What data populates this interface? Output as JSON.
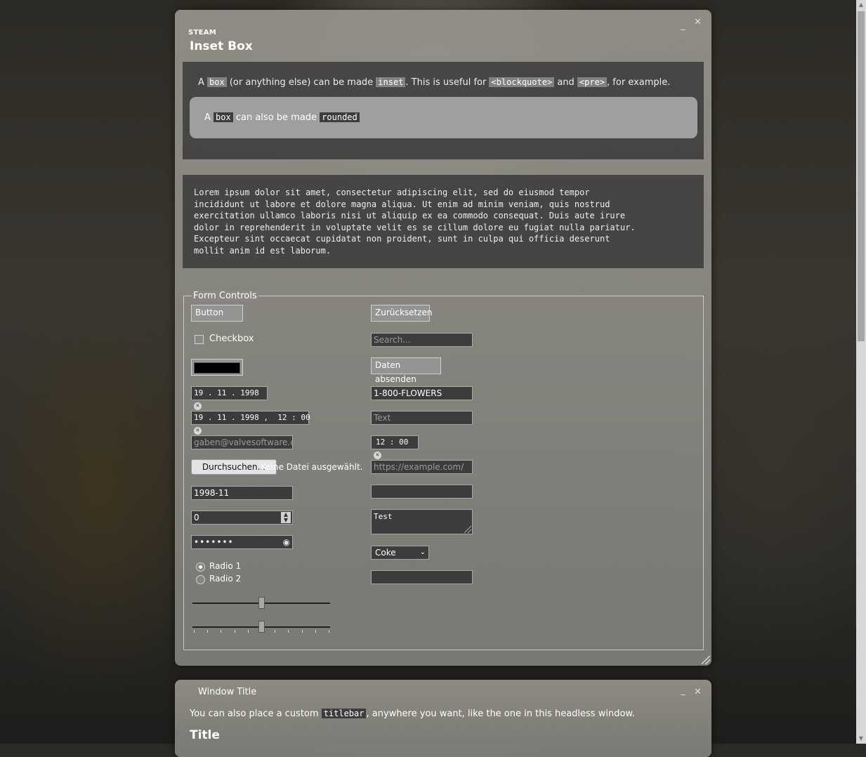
{
  "window1": {
    "app_label": "STEAM",
    "title": "Inset Box",
    "minimize": "_",
    "close": "✕",
    "inset_text": {
      "p1": "A ",
      "c1": "box",
      "p2": " (or anything else) can be made ",
      "c2": "inset",
      "p3": ". This is useful for ",
      "c3": "<blockquote>",
      "p4": " and ",
      "c4": "<pre>",
      "p5": ", for example."
    },
    "rounded_text": {
      "p1": "A ",
      "c1": "box",
      "p2": " can also be made ",
      "c2": "rounded"
    },
    "pre_text": "Lorem ipsum dolor sit amet, consectetur adipiscing elit, sed do eiusmod tempor\nincididunt ut labore et dolore magna aliqua. Ut enim ad minim veniam, quis nostrud\nexercitation ullamco laboris nisi ut aliquip ex ea commodo consequat. Duis aute irure\ndolor in reprehenderit in voluptate velit es se cillum dolore eu fugiat nulla pariatur.\nExcepteur sint occaecat cupidatat non proident, sunt in culpa qui officia deserunt\nmollit anim id est laborum.",
    "form": {
      "legend": "Form Controls",
      "button_label": "Button",
      "checkbox_label": "Checkbox",
      "color_value": "#000000",
      "date_value": "19 . 11 . 1998",
      "datetime_value": "19 . 11 . 1998 ,  12 : 00",
      "email_value": "gaben@valvesoftware.cc",
      "file_button": "Durchsuchen...",
      "file_status": "Keine Datei ausgewählt.",
      "month_value": "1998-11",
      "number_value": "0",
      "password_value": "•••••••",
      "radio1": "Radio 1",
      "radio2": "Radio 2",
      "range_value": 50,
      "reset_label": "Zurücksetzen",
      "search_placeholder": "Search...",
      "submit_label": "Daten absenden",
      "tel_value": "1-800-FLOWERS",
      "text_placeholder": "Text",
      "time_value": "12 : 00",
      "url_placeholder": "https://example.com/",
      "textarea_value": "Test",
      "select_value": "Coke"
    }
  },
  "window2": {
    "title": "Window Title",
    "minimize": "_",
    "close": "✕",
    "text_p1": "You can also place a custom ",
    "text_code": "titlebar",
    "text_p2": ", anywhere you want, like the one in this headless window.",
    "heading": "Title"
  }
}
